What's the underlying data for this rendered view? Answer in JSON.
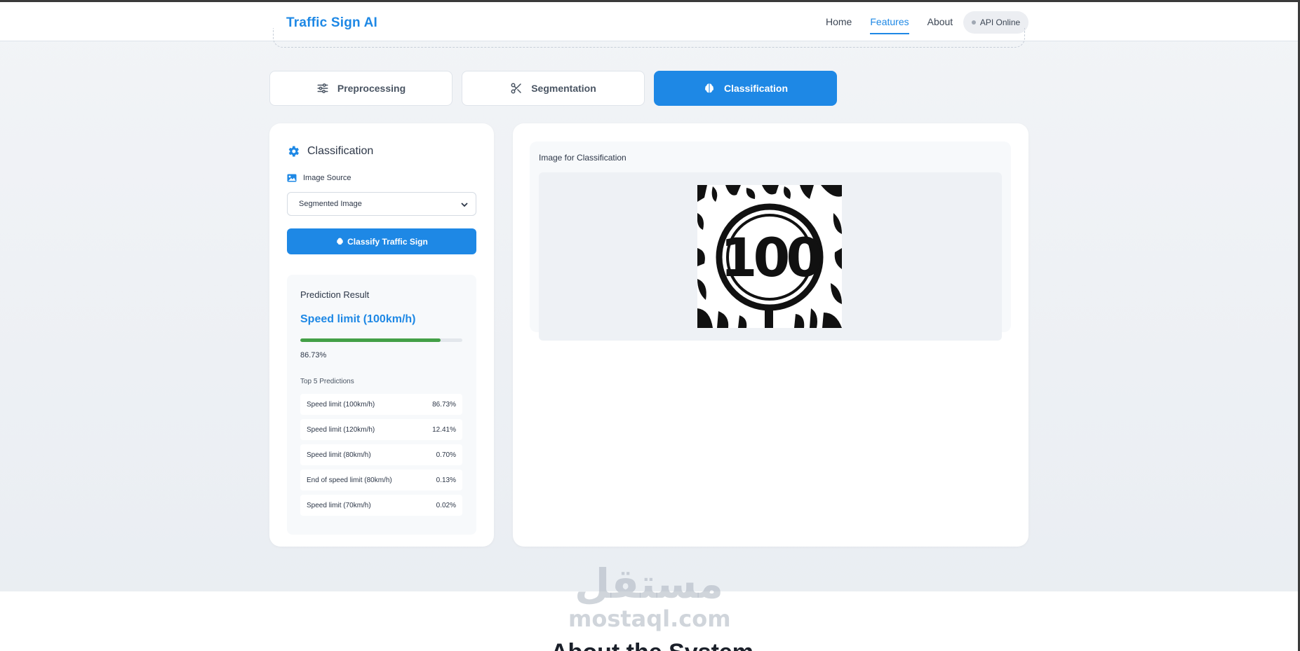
{
  "header": {
    "brand": "Traffic Sign AI",
    "nav": [
      "Home",
      "Features",
      "About"
    ],
    "active_nav": "Features",
    "api_status": "API Online"
  },
  "tabs": [
    {
      "label": "Preprocessing",
      "icon": "sliders-icon",
      "active": false
    },
    {
      "label": "Segmentation",
      "icon": "scissors-icon",
      "active": false
    },
    {
      "label": "Classification",
      "icon": "brain-icon",
      "active": true
    }
  ],
  "left_panel": {
    "title": "Classification",
    "title_icon": "gear-icon",
    "image_source_label": "Image Source",
    "image_source_value": "Segmented Image",
    "classify_button": "Classify Traffic Sign",
    "result": {
      "heading": "Prediction Result",
      "class_name": "Speed limit (100km/h)",
      "confidence_text": "86.73%",
      "confidence": 0.8673,
      "top5_label": "Top 5 Predictions",
      "predictions": [
        {
          "name": "Speed limit (100km/h)",
          "pct": "86.73%"
        },
        {
          "name": "Speed limit (120km/h)",
          "pct": "12.41%"
        },
        {
          "name": "Speed limit (80km/h)",
          "pct": "0.70%"
        },
        {
          "name": "End of speed limit (80km/h)",
          "pct": "0.13%"
        },
        {
          "name": "Speed limit (70km/h)",
          "pct": "0.02%"
        }
      ]
    }
  },
  "right_panel": {
    "image_title": "Image for Classification",
    "sign_text": "100"
  },
  "watermark": {
    "arabic": "مستقل",
    "latin": "mostaql.com"
  },
  "bottom_heading": "About the System",
  "colors": {
    "accent": "#1e88e5",
    "success": "#43a047"
  }
}
